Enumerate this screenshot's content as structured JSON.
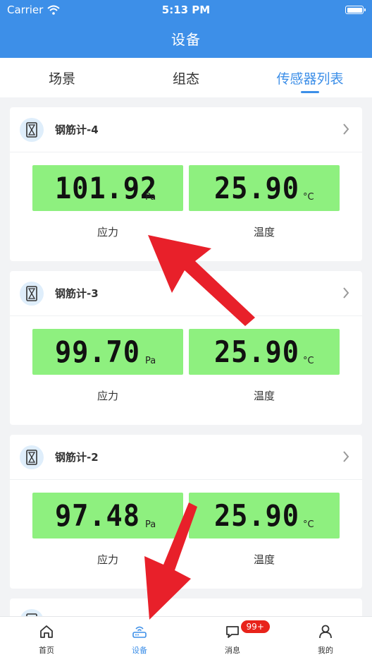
{
  "status_bar": {
    "carrier": "Carrier",
    "time": "5:13 PM"
  },
  "header": {
    "title": "设备"
  },
  "tabs": [
    {
      "label": "场景",
      "active": false
    },
    {
      "label": "组态",
      "active": false
    },
    {
      "label": "传感器列表",
      "active": true
    }
  ],
  "sensors": [
    {
      "name": "钢筋计-4",
      "stress_value": "101.92",
      "stress_unit": "Pa",
      "stress_label": "应力",
      "temp_value": "25.90",
      "temp_unit": "°C",
      "temp_label": "温度"
    },
    {
      "name": "钢筋计-3",
      "stress_value": "99.70",
      "stress_unit": "Pa",
      "stress_label": "应力",
      "temp_value": "25.90",
      "temp_unit": "°C",
      "temp_label": "温度"
    },
    {
      "name": "钢筋计-2",
      "stress_value": "97.48",
      "stress_unit": "Pa",
      "stress_label": "应力",
      "temp_value": "25.90",
      "temp_unit": "°C",
      "temp_label": "温度"
    }
  ],
  "bottom_nav": [
    {
      "label": "首页",
      "icon": "home-icon",
      "active": false
    },
    {
      "label": "设备",
      "icon": "router-icon",
      "active": true
    },
    {
      "label": "消息",
      "icon": "chat-icon",
      "active": false,
      "badge": "99+"
    },
    {
      "label": "我的",
      "icon": "person-icon",
      "active": false
    }
  ],
  "colors": {
    "primary": "#3d8fe8",
    "lcd": "#8ef07f",
    "badge": "#e8231b",
    "annotation_arrow": "#e8202a"
  }
}
